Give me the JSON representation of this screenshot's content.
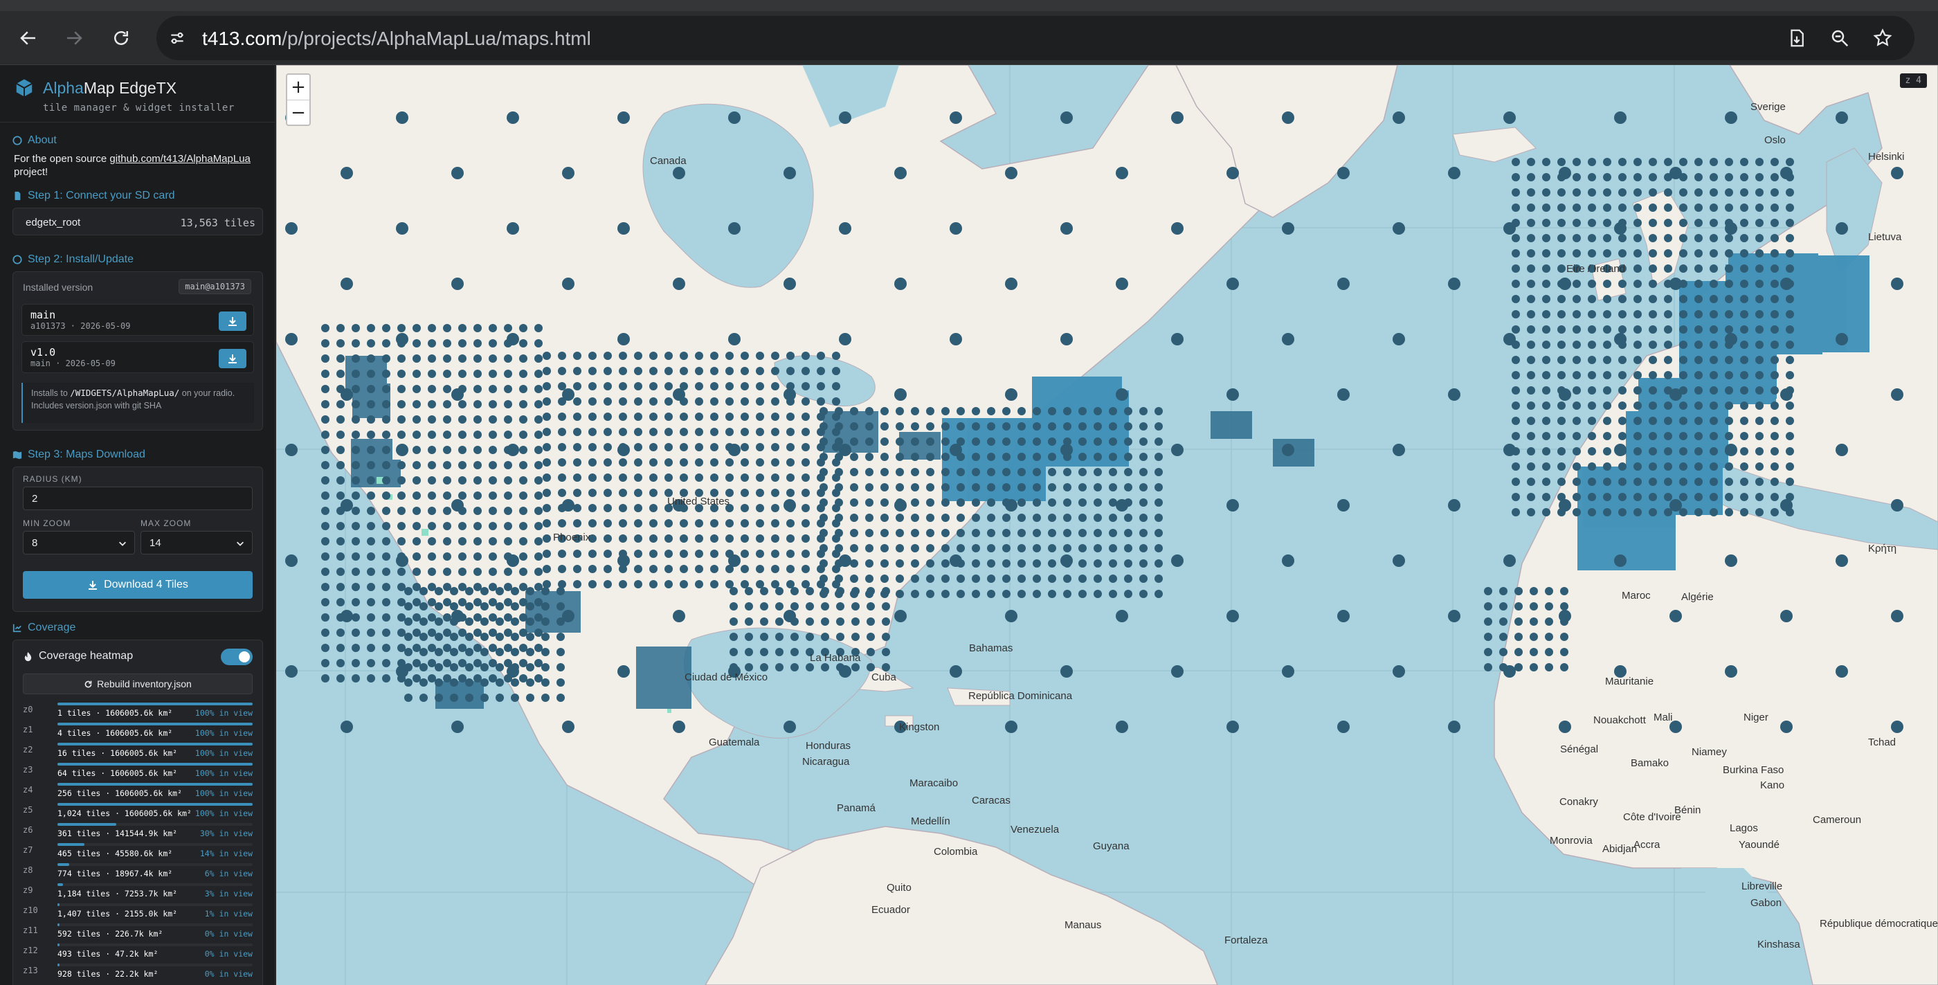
{
  "browser": {
    "url_host": "t413.com",
    "url_path": "/p/projects/AlphaMapLua/maps.html"
  },
  "sidebar": {
    "brand_alpha": "Alpha",
    "brand_rest": "Map EdgeTX",
    "brand_sub": "tile manager & widget installer",
    "about": {
      "heading": "About",
      "text_prefix": "For the open source ",
      "link": "github.com/t413/AlphaMapLua",
      "text_suffix": " project!"
    },
    "step1": {
      "heading": "Step 1: Connect your SD card",
      "sd_name": "edgetx_root",
      "sd_count": "13,563 tiles"
    },
    "step2": {
      "heading": "Step 2: Install/Update",
      "installed_label": "Installed version",
      "installed_badge": "main@a101373",
      "versions": [
        {
          "name": "main",
          "meta": "a101373 · 2026-05-09"
        },
        {
          "name": "v1.0",
          "meta": "main · 2026-05-09"
        }
      ],
      "note_prefix": "Installs to ",
      "note_path": "/WIDGETS/AlphaMapLua/",
      "note_suffix": " on your radio. Includes version.json with git SHA"
    },
    "step3": {
      "heading": "Step 3: Maps Download",
      "radius_label": "RADIUS (KM)",
      "radius_value": "2",
      "min_zoom_label": "MIN ZOOM",
      "min_zoom_value": "8",
      "max_zoom_label": "MAX ZOOM",
      "max_zoom_value": "14",
      "download_label": "Download  4  Tiles"
    },
    "coverage": {
      "heading": "Coverage",
      "heatmap_label": "Coverage heatmap",
      "heatmap_on": true,
      "rebuild_label": "Rebuild inventory.json",
      "rows": [
        {
          "level": "z0",
          "info": "1 tiles · 1606005.6k km²",
          "pct": "100% in view",
          "fill": 1.0
        },
        {
          "level": "z1",
          "info": "4 tiles · 1606005.6k km²",
          "pct": "100% in view",
          "fill": 1.0
        },
        {
          "level": "z2",
          "info": "16 tiles · 1606005.6k km²",
          "pct": "100% in view",
          "fill": 1.0
        },
        {
          "level": "z3",
          "info": "64 tiles · 1606005.6k km²",
          "pct": "100% in view",
          "fill": 1.0
        },
        {
          "level": "z4",
          "info": "256 tiles · 1606005.6k km²",
          "pct": "100% in view",
          "fill": 1.0
        },
        {
          "level": "z5",
          "info": "1,024 tiles · 1606005.6k km²",
          "pct": "100% in view",
          "fill": 1.0
        },
        {
          "level": "z6",
          "info": "361 tiles · 141544.9k km²",
          "pct": "30% in view",
          "fill": 0.3
        },
        {
          "level": "z7",
          "info": "465 tiles · 45580.6k km²",
          "pct": "14% in view",
          "fill": 0.14
        },
        {
          "level": "z8",
          "info": "774 tiles · 18967.4k km²",
          "pct": "6% in view",
          "fill": 0.06
        },
        {
          "level": "z9",
          "info": "1,184 tiles · 7253.7k km²",
          "pct": "3% in view",
          "fill": 0.03
        },
        {
          "level": "z10",
          "info": "1,407 tiles · 2155.0k km²",
          "pct": "1% in view",
          "fill": 0.01
        },
        {
          "level": "z11",
          "info": "592 tiles · 226.7k km²",
          "pct": "0% in view",
          "fill": 0.0
        },
        {
          "level": "z12",
          "info": "493 tiles · 47.2k km²",
          "pct": "0% in view",
          "fill": 0.0
        },
        {
          "level": "z13",
          "info": "928 tiles · 22.2k km²",
          "pct": "0% in view",
          "fill": 0.0
        }
      ]
    }
  },
  "map": {
    "zoom_in": "+",
    "zoom_out": "−",
    "zoom_indicator": "z 4",
    "labels": [
      "Canada",
      "United States",
      "Phoenix",
      "Ciudad de México",
      "La Habana",
      "Bahamas",
      "Cuba",
      "República Dominicana",
      "Kingston",
      "Guatemala",
      "Honduras",
      "Nicaragua",
      "Panamá",
      "Maracaibo",
      "Caracas",
      "Venezuela",
      "Medellín",
      "Colombia",
      "Guyana",
      "Quito",
      "Ecuador",
      "Manaus",
      "Fortaleza",
      "Sverige",
      "Oslo",
      "Helsinki",
      "Eire / Ireland",
      "Lietuva",
      "Maroc",
      "Algérie",
      "Mauritanie",
      "Mali",
      "Niger",
      "Tchad",
      "Nouakchott",
      "Sénégal",
      "Bamako",
      "Niamey",
      "Burkina Faso",
      "Kano",
      "Conakry",
      "Côte d'Ivoire",
      "Bénin",
      "Lagos",
      "Monrovia",
      "Abidjan",
      "Accra",
      "Yaoundé",
      "Libreville",
      "Gabon",
      "Cameroun",
      "Kinshasa",
      "République démocratique du Congo",
      "Κρήτη"
    ]
  },
  "colors": {
    "accent": "#3b8fbb",
    "water": "#aad3df",
    "land": "#f2efe9",
    "marker": "#2f5d75",
    "coverage": "#3d8fb8"
  }
}
